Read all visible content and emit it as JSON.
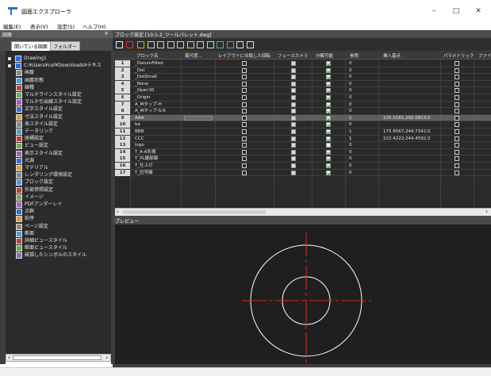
{
  "window": {
    "title": "図面エクスプローラ",
    "minimize": "–",
    "maximize": "□",
    "close": "✕"
  },
  "menu": [
    "編集(E)",
    "表示(V)",
    "設定(S)",
    "ヘルプ(H)"
  ],
  "left_panel": {
    "header": "図面",
    "close": "×",
    "tabs": [
      "開いている図面",
      "フォルダー"
    ],
    "tree": [
      {
        "label": "Drawing1",
        "level": 0,
        "icon": "drawing-icon"
      },
      {
        "label": "C:¥Users¥cel¥Downloads¥テキス",
        "level": 0,
        "icon": "drawing-icon"
      },
      {
        "label": "画層",
        "level": 1,
        "icon": "layer-icon"
      },
      {
        "label": "画層状態",
        "level": 1,
        "icon": "layer-state-icon"
      },
      {
        "label": "線種",
        "level": 1,
        "icon": "linetype-icon"
      },
      {
        "label": "マルチラインスタイル設定",
        "level": 1,
        "icon": "multiline-icon"
      },
      {
        "label": "マルチ引出線スタイル設定",
        "level": 1,
        "icon": "mleader-icon"
      },
      {
        "label": "文字スタイル設定",
        "level": 1,
        "icon": "text-style-icon"
      },
      {
        "label": "寸法スタイル設定",
        "level": 1,
        "icon": "dim-style-icon"
      },
      {
        "label": "表スタイル設定",
        "level": 1,
        "icon": "table-style-icon"
      },
      {
        "label": "データリンク",
        "level": 1,
        "icon": "datalink-icon"
      },
      {
        "label": "座標設定",
        "level": 1,
        "icon": "ucs-icon"
      },
      {
        "label": "ビュー設定",
        "level": 1,
        "icon": "view-icon"
      },
      {
        "label": "表示スタイル設定",
        "level": 1,
        "icon": "visual-style-icon"
      },
      {
        "label": "光源",
        "level": 1,
        "icon": "light-icon"
      },
      {
        "label": "マテリアル",
        "level": 1,
        "icon": "material-icon"
      },
      {
        "label": "レンダリング環境設定",
        "level": 1,
        "icon": "render-icon"
      },
      {
        "label": "ブロック設定",
        "level": 1,
        "icon": "block-icon"
      },
      {
        "label": "外部参照設定",
        "level": 1,
        "icon": "xref-icon"
      },
      {
        "label": "イメージ",
        "level": 1,
        "icon": "image-icon"
      },
      {
        "label": "PDFアンダーレイ",
        "level": 1,
        "icon": "pdf-icon"
      },
      {
        "label": "点群",
        "level": 1,
        "icon": "pointcloud-icon"
      },
      {
        "label": "彩序",
        "level": 1,
        "icon": "order-icon"
      },
      {
        "label": "ページ設定",
        "level": 1,
        "icon": "page-setup-icon"
      },
      {
        "label": "断面",
        "level": 1,
        "icon": "section-icon"
      },
      {
        "label": "詳細ビュースタイル",
        "level": 1,
        "icon": "detail-view-icon"
      },
      {
        "label": "断面ビュースタイル",
        "level": 1,
        "icon": "section-view-icon"
      },
      {
        "label": "破損したシンボルのスタイル",
        "level": 1,
        "icon": "broken-symbol-icon"
      }
    ]
  },
  "right_panel": {
    "header": "ブロック設定 [10-1-2_ツールパレット.dwg]",
    "toolbar_icons": [
      "new-icon",
      "delete-icon",
      "purge-icon",
      "copy-icon",
      "paste-icon",
      "copy2-icon",
      "paste2-icon",
      "edit-icon",
      "copy3-icon",
      "paste3-icon",
      "refresh-icon",
      "settings-icon",
      "grid-view-icon",
      "list-view-icon"
    ],
    "columns": [
      "ブロック名",
      "異尺度...",
      "レイアウトに合致した回転",
      "フェースカメラ",
      "分解可能",
      "参照",
      "挿入基点",
      "パラメトリック",
      "ファイル"
    ],
    "rows": [
      {
        "num": "1",
        "name": "_DatumFilled",
        "scale": "",
        "layout": false,
        "face": "gray",
        "explode": true,
        "ref": "0",
        "base": "",
        "param": false,
        "selected": false
      },
      {
        "num": "2",
        "name": "_Dot",
        "scale": "",
        "layout": false,
        "face": "gray",
        "explode": true,
        "ref": "0",
        "base": "",
        "param": false,
        "selected": false
      },
      {
        "num": "3",
        "name": "_DotSmall",
        "scale": "",
        "layout": false,
        "face": "gray",
        "explode": true,
        "ref": "0",
        "base": "",
        "param": false,
        "selected": false
      },
      {
        "num": "4",
        "name": "_None",
        "scale": "",
        "layout": false,
        "face": "gray",
        "explode": true,
        "ref": "0",
        "base": "",
        "param": false,
        "selected": false
      },
      {
        "num": "5",
        "name": "_Open30",
        "scale": "",
        "layout": false,
        "face": "gray",
        "explode": true,
        "ref": "0",
        "base": "",
        "param": false,
        "selected": false
      },
      {
        "num": "6",
        "name": "_Origin",
        "scale": "",
        "layout": false,
        "face": "gray",
        "explode": true,
        "ref": "0",
        "base": "",
        "param": false,
        "selected": false
      },
      {
        "num": "7",
        "name": "A_Mタップ-H",
        "scale": "",
        "layout": false,
        "face": "gray",
        "explode": true,
        "ref": "0",
        "base": "",
        "param": false,
        "selected": false
      },
      {
        "num": "8",
        "name": "A_Mタップ-S-K",
        "scale": "",
        "layout": false,
        "face": "gray",
        "explode": true,
        "ref": "0",
        "base": "",
        "param": false,
        "selected": false
      },
      {
        "num": "9",
        "name": "AAA",
        "scale": "",
        "layout": false,
        "face": "gray",
        "explode": true,
        "ref": "1",
        "base": "135.5181,250.0813,0",
        "param": false,
        "selected": true
      },
      {
        "num": "10",
        "name": "ba",
        "scale": "",
        "layout": false,
        "face": "gray",
        "explode": true,
        "ref": "0",
        "base": "",
        "param": false,
        "selected": false
      },
      {
        "num": "11",
        "name": "BBB",
        "scale": "",
        "layout": false,
        "face": "gray",
        "explode": true,
        "ref": "1",
        "base": "175.8567,244.7342,0",
        "param": false,
        "selected": false
      },
      {
        "num": "12",
        "name": "CCC",
        "scale": "",
        "layout": false,
        "face": "gray",
        "explode": true,
        "ref": "1",
        "base": "222.4222,244.4592,0",
        "param": false,
        "selected": false
      },
      {
        "num": "13",
        "name": "logo",
        "scale": "",
        "layout": false,
        "face": "gray",
        "explode": false,
        "ref": "0",
        "base": "",
        "param": false,
        "selected": false
      },
      {
        "num": "14",
        "name": "T_A-A矢視",
        "scale": "",
        "layout": false,
        "face": "gray",
        "explode": true,
        "ref": "0",
        "base": "",
        "param": false,
        "selected": false
      },
      {
        "num": "15",
        "name": "T_PL継部線",
        "scale": "",
        "layout": false,
        "face": "gray",
        "explode": true,
        "ref": "0",
        "base": "",
        "param": false,
        "selected": false
      },
      {
        "num": "16",
        "name": "T_仕上げ",
        "scale": "",
        "layout": false,
        "face": "gray",
        "explode": true,
        "ref": "0",
        "base": "",
        "param": false,
        "selected": false
      },
      {
        "num": "17",
        "name": "T_記号線",
        "scale": "",
        "layout": false,
        "face": "gray",
        "explode": true,
        "ref": "0",
        "base": "",
        "param": false,
        "selected": false
      }
    ],
    "preview_label": "プレビュー"
  },
  "colors": {
    "dark_bg": "#2a2a2a",
    "header_bg": "#3a3a3a",
    "selected_row": "#5e5e5e",
    "crosshair": "#e02020",
    "circle": "#ffffff",
    "check": "#3aa63a"
  }
}
